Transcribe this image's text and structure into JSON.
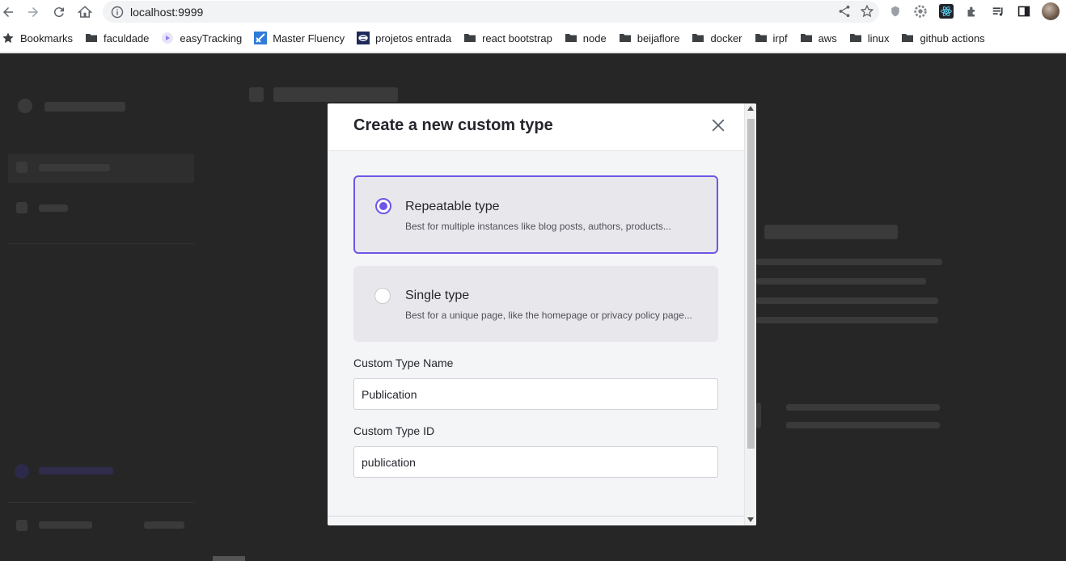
{
  "browser": {
    "url": "localhost:9999"
  },
  "bookmarks": [
    {
      "label": "Bookmarks",
      "icon": "star-icon"
    },
    {
      "label": "faculdade",
      "icon": "folder-icon"
    },
    {
      "label": "easyTracking",
      "icon": "easytracking-icon"
    },
    {
      "label": "Master Fluency",
      "icon": "master-fluency-icon"
    },
    {
      "label": "projetos entrada",
      "icon": "projetos-entrada-icon"
    },
    {
      "label": "react bootstrap",
      "icon": "folder-icon"
    },
    {
      "label": "node",
      "icon": "folder-icon"
    },
    {
      "label": "beijaflore",
      "icon": "folder-icon"
    },
    {
      "label": "docker",
      "icon": "folder-icon"
    },
    {
      "label": "irpf",
      "icon": "folder-icon"
    },
    {
      "label": "aws",
      "icon": "folder-icon"
    },
    {
      "label": "linux",
      "icon": "folder-icon"
    },
    {
      "label": "github actions",
      "icon": "folder-icon"
    }
  ],
  "modal": {
    "title": "Create a new custom type",
    "options": [
      {
        "title": "Repeatable type",
        "description": "Best for multiple instances like blog posts, authors, products...",
        "selected": true
      },
      {
        "title": "Single type",
        "description": "Best for a unique page, like the homepage or privacy policy page...",
        "selected": false
      }
    ],
    "name_label": "Custom Type Name",
    "name_value": "Publication",
    "id_label": "Custom Type ID",
    "id_value": "publication"
  },
  "colors": {
    "accent": "#6e56e6",
    "overlay": "#262626",
    "modal_bg": "#f4f5f7"
  }
}
